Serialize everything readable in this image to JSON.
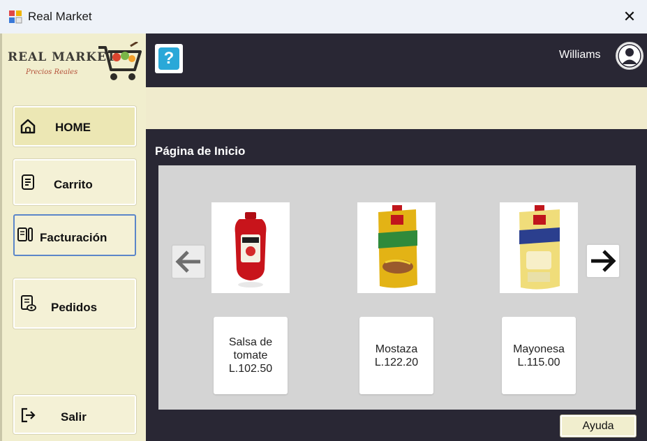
{
  "window": {
    "title": "Real Market",
    "close_glyph": "✕"
  },
  "sidebar": {
    "logo_text": "REAL MARKET",
    "logo_tagline": "Precios Reales",
    "nav": [
      {
        "label": "HOME",
        "icon": "home-icon"
      },
      {
        "label": "Carrito",
        "icon": "cart-list-icon"
      },
      {
        "label": "Facturación",
        "icon": "invoice-icon"
      },
      {
        "label": "Pedidos",
        "icon": "orders-icon"
      },
      {
        "label": "Salir",
        "icon": "exit-icon"
      }
    ]
  },
  "header": {
    "help_glyph": "?",
    "username": "Williams"
  },
  "main": {
    "page_title": "Página de Inicio",
    "products": [
      {
        "name": "Salsa de tomate",
        "price": "L.102.50",
        "image": "ketchup-bottle",
        "color": "#c8141b"
      },
      {
        "name": "Mostaza",
        "price": "L.122.20",
        "image": "mustard-pouch",
        "color": "#e3b315"
      },
      {
        "name": "Mayonesa",
        "price": "L.115.00",
        "image": "mayonnaise-pouch",
        "color": "#f0dd7a"
      }
    ],
    "help_button": "Ayuda"
  },
  "colors": {
    "dark_bg": "#292734",
    "cream": "#f1eece",
    "carousel_bg": "#d4d4d4",
    "help_blue": "#2aa8d8"
  }
}
